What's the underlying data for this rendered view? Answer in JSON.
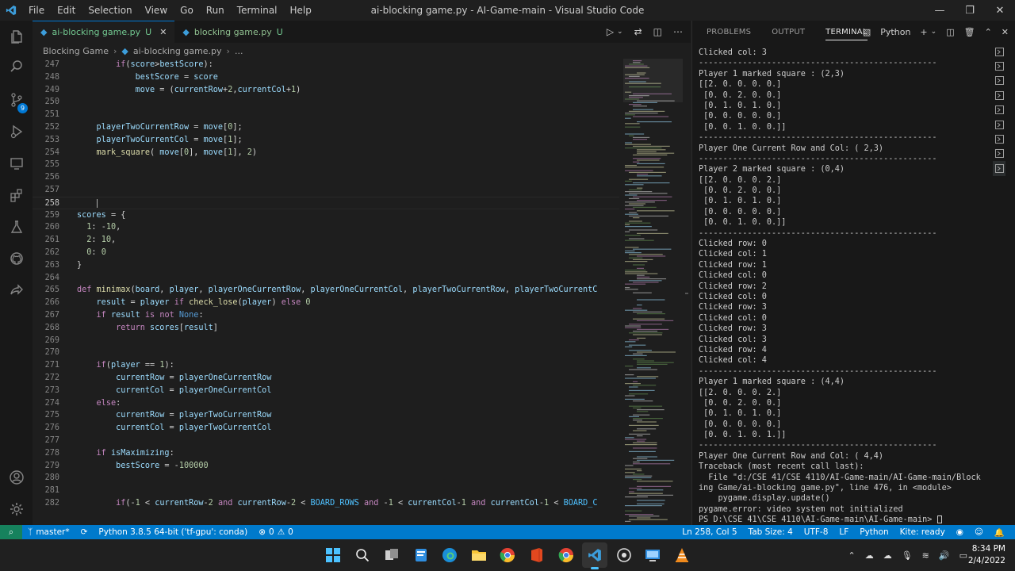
{
  "window": {
    "title": "ai-blocking game.py - AI-Game-main - Visual Studio Code",
    "menu": [
      "File",
      "Edit",
      "Selection",
      "View",
      "Go",
      "Run",
      "Terminal",
      "Help"
    ]
  },
  "activity_bar": {
    "items": [
      "explorer-icon",
      "search-icon",
      "source-control-icon",
      "run-debug-icon",
      "remote-explorer-icon",
      "extensions-icon",
      "testing-icon",
      "github-icon",
      "live-share-icon",
      "accounts-icon",
      "manage-icon"
    ],
    "source_control_badge": "9"
  },
  "editor": {
    "tabs": [
      {
        "name": "ai-blocking game.py",
        "status": "U",
        "active": true
      },
      {
        "name": "blocking game.py",
        "status": "U",
        "active": false
      }
    ],
    "breadcrumb": [
      "Blocking Game",
      "ai-blocking game.py",
      "..."
    ],
    "current_line": "258",
    "lines": [
      {
        "n": "247",
        "t": "        if(score>bestScore):"
      },
      {
        "n": "248",
        "t": "            bestScore = score"
      },
      {
        "n": "249",
        "t": "            move = (currentRow+2,currentCol+1)"
      },
      {
        "n": "250",
        "t": ""
      },
      {
        "n": "251",
        "t": ""
      },
      {
        "n": "252",
        "t": "    playerTwoCurrentRow = move[0];"
      },
      {
        "n": "253",
        "t": "    playerTwoCurrentCol = move[1];"
      },
      {
        "n": "254",
        "t": "    mark_square( move[0], move[1], 2)"
      },
      {
        "n": "255",
        "t": ""
      },
      {
        "n": "256",
        "t": ""
      },
      {
        "n": "257",
        "t": ""
      },
      {
        "n": "258",
        "t": ""
      },
      {
        "n": "259",
        "t": "scores = {"
      },
      {
        "n": "260",
        "t": "  1: -10,"
      },
      {
        "n": "261",
        "t": "  2: 10,"
      },
      {
        "n": "262",
        "t": "  0: 0"
      },
      {
        "n": "263",
        "t": "}"
      },
      {
        "n": "264",
        "t": ""
      },
      {
        "n": "265",
        "t": "def minimax(board, player, playerOneCurrentRow, playerOneCurrentCol, playerTwoCurrentRow, playerTwoCurrentC"
      },
      {
        "n": "266",
        "t": "    result = player if check_lose(player) else 0"
      },
      {
        "n": "267",
        "t": "    if result is not None:"
      },
      {
        "n": "268",
        "t": "        return scores[result]"
      },
      {
        "n": "269",
        "t": ""
      },
      {
        "n": "270",
        "t": ""
      },
      {
        "n": "271",
        "t": "    if(player == 1):"
      },
      {
        "n": "272",
        "t": "        currentRow = playerOneCurrentRow"
      },
      {
        "n": "273",
        "t": "        currentCol = playerOneCurrentCol"
      },
      {
        "n": "274",
        "t": "    else:"
      },
      {
        "n": "275",
        "t": "        currentRow = playerTwoCurrentRow"
      },
      {
        "n": "276",
        "t": "        currentCol = playerTwoCurrentCol"
      },
      {
        "n": "277",
        "t": ""
      },
      {
        "n": "278",
        "t": "    if isMaximizing:"
      },
      {
        "n": "279",
        "t": "        bestScore = -100000"
      },
      {
        "n": "280",
        "t": ""
      },
      {
        "n": "281",
        "t": ""
      },
      {
        "n": "282",
        "t": "        if(-1 < currentRow-2 and currentRow-2 < BOARD_ROWS and -1 < currentCol-1 and currentCol-1 < BOARD_C"
      }
    ]
  },
  "panel": {
    "tabs": [
      "PROBLEMS",
      "OUTPUT",
      "TERMINAL",
      "···"
    ],
    "active_tab": "TERMINAL",
    "terminal_name": "Python",
    "terminal_lines": [
      "Clicked col: 3",
      "-------------------------------------------------",
      "Player 1 marked square : (2,3)",
      "[[2. 0. 0. 0. 0.]",
      " [0. 0. 2. 0. 0.]",
      " [0. 1. 0. 1. 0.]",
      " [0. 0. 0. 0. 0.]",
      " [0. 0. 1. 0. 0.]]",
      "-------------------------------------------------",
      "Player One Current Row and Col: ( 2,3)",
      "-------------------------------------------------",
      "Player 2 marked square : (0,4)",
      "[[2. 0. 0. 0. 2.]",
      " [0. 0. 2. 0. 0.]",
      " [0. 1. 0. 1. 0.]",
      " [0. 0. 0. 0. 0.]",
      " [0. 0. 1. 0. 0.]]",
      "-------------------------------------------------",
      "Clicked row: 0",
      "Clicked col: 1",
      "Clicked row: 1",
      "Clicked col: 0",
      "Clicked row: 2",
      "Clicked col: 0",
      "Clicked row: 3",
      "Clicked col: 0",
      "Clicked row: 3",
      "Clicked col: 3",
      "Clicked row: 4",
      "Clicked col: 4",
      "-------------------------------------------------",
      "Player 1 marked square : (4,4)",
      "[[2. 0. 0. 0. 2.]",
      " [0. 0. 2. 0. 0.]",
      " [0. 1. 0. 1. 0.]",
      " [0. 0. 0. 0. 0.]",
      " [0. 0. 1. 0. 1.]]",
      "-------------------------------------------------",
      "Player One Current Row and Col: ( 4,4)",
      "Traceback (most recent call last):",
      "  File \"d:/CSE 41/CSE 4110/AI-Game-main/AI-Game-main/Block",
      "ing Game/ai-blocking game.py\", line 476, in <module>",
      "    pygame.display.update()",
      "pygame.error: video system not initialized",
      "PS D:\\CSE 41\\CSE 4110\\AI-Game-main\\AI-Game-main> "
    ]
  },
  "statusbar": {
    "branch": "master*",
    "interpreter": "Python 3.8.5 64-bit ('tf-gpu': conda)",
    "errors": "0",
    "warnings": "0",
    "position": "Ln 258, Col 5",
    "tab_size": "Tab Size: 4",
    "encoding": "UTF-8",
    "eol": "LF",
    "language": "Python",
    "formatter": "Kite: ready"
  },
  "taskbar": {
    "apps": [
      "windows-start-icon",
      "search-icon",
      "task-view-icon",
      "notepad-icon",
      "edge-icon",
      "file-explorer-icon",
      "chrome-icon",
      "office-icon",
      "chrome-profile-icon",
      "vscode-icon",
      "github-desktop-icon",
      "remote-desktop-icon",
      "vlc-icon"
    ],
    "time": "8:34 PM",
    "date": "2/4/2022"
  },
  "colors": {
    "statusbar": "#007acc",
    "keyword": "#c586c0",
    "function": "#dcdcaa",
    "variable": "#9cdcfe",
    "number": "#b5cea8",
    "constant": "#4fc1ff"
  }
}
